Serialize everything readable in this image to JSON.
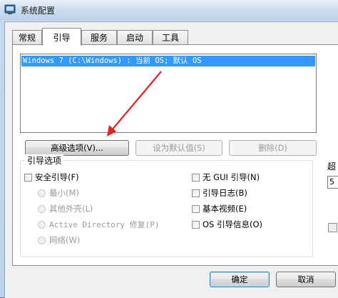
{
  "window": {
    "title": "系统配置"
  },
  "tabs": [
    {
      "label": "常规"
    },
    {
      "label": "引导"
    },
    {
      "label": "服务"
    },
    {
      "label": "启动"
    },
    {
      "label": "工具"
    }
  ],
  "boot_list": {
    "items": [
      "Windows 7 (C:\\Windows) : 当前 OS; 默认 OS"
    ]
  },
  "boot_buttons": {
    "advanced": "高级选项(V)...",
    "set_default": "设为默认值(S)",
    "delete": "删除(D)"
  },
  "boot_options": {
    "label": "引导选项",
    "safe_boot": "安全引导(F)",
    "minimal": "最小(M)",
    "alternate_shell": "其他外壳(L)",
    "active_directory": "Active Directory 修复(P)",
    "network": "网络(W)",
    "no_gui": "无 GUI 引导(N)",
    "boot_log": "引导日志(B)",
    "base_video": "基本视频(E)",
    "os_boot_info": "OS 引导信息(O)"
  },
  "right_partial": {
    "label": "超",
    "value": "5"
  },
  "dialog_buttons": {
    "ok": "确定",
    "cancel": "取消"
  },
  "colors": {
    "selection": "#3399ff",
    "arrow": "#e52020"
  }
}
